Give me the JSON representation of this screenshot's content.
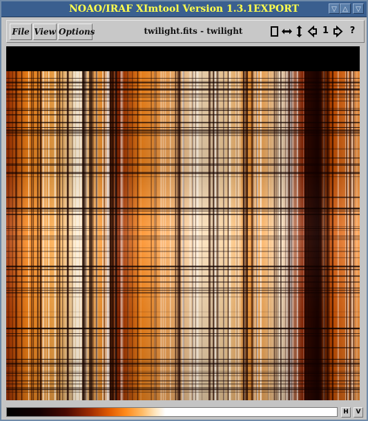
{
  "window": {
    "title": "NOAO/IRAF XImtool Version 1.3.1EXPORT",
    "controls": [
      "▽",
      "△",
      "▽",
      "△"
    ]
  },
  "menu": {
    "file": "File",
    "view": "View",
    "options": "Options"
  },
  "image_title": "twilight.fits - twilight",
  "nav": {
    "frame_number": "1",
    "fit_icon": "fit-frame-icon",
    "horizontal_icon": "horizontal-arrows-icon",
    "vertical_icon": "vertical-arrows-icon",
    "prev_icon": "previous-frame-icon",
    "next_icon": "next-frame-icon",
    "help_label": "?"
  },
  "colorbar": {
    "h_label": "H",
    "v_label": "V"
  },
  "colors": {
    "titlebar": "#3a5f8f",
    "title_text": "#ffff4d",
    "image_hot": "#ff8a1a"
  }
}
